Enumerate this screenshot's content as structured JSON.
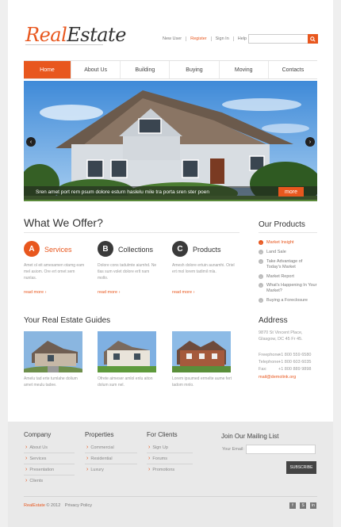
{
  "header": {
    "logo_part1": "Real",
    "logo_part2": "Estate",
    "toplinks": [
      "New User",
      "Register",
      "Sign In",
      "Help"
    ],
    "search_placeholder": ""
  },
  "nav": [
    "Home",
    "About Us",
    "Building",
    "Buying",
    "Moving",
    "Contacts"
  ],
  "slider": {
    "caption": "Sren amet port rem psum dolore esturn haslelu mile tra porta sren ster poen",
    "more_label": "more",
    "prev": "‹",
    "next": "›"
  },
  "offer": {
    "title": "What We Offer?",
    "items": [
      {
        "letter": "A",
        "title": "Services",
        "text": "Amet ol eit amesamen otamg eam mel asiom. Ore ert omet sem nunlas.",
        "more": "read more",
        "color": "#e8571e"
      },
      {
        "letter": "B",
        "title": "Collections",
        "text": "Dolore cons tadulmte aiumhd. Ne tlas sum volet dolore erlt nam mollo.",
        "more": "read more",
        "color": "#3a3a3a"
      },
      {
        "letter": "C",
        "title": "Products",
        "text": "Amesh dolore ertuin aunamhi. Oriel ert mol lorem tadimil mla.",
        "more": "read more",
        "color": "#3a3a3a"
      }
    ]
  },
  "products": {
    "title": "Our Products",
    "items": [
      "Market Insight",
      "Land Sale",
      "Take Advantage of Today's Market",
      "Market Report",
      "What's Happening In Your Market?",
      "Buying a Foreclosure"
    ]
  },
  "guides": {
    "title": "Your Real Estate Guides",
    "items": [
      {
        "text": "Amelu tad erte tumlahe dolium amet meulu tadee."
      },
      {
        "text": "Ofrete aimeser amlol enlu aiton dolum sum nel."
      },
      {
        "text": "Lorem ipsumed ermelte aume fert tadom mnlo."
      }
    ]
  },
  "address": {
    "title": "Address",
    "street": "9870 St Vincent Place,",
    "city": "Glasgow, DC 45 Fr 45.",
    "phones": [
      {
        "label": "Freephone:",
        "value": "+1 800 559 6580"
      },
      {
        "label": "Telephone:",
        "value": "+1 800 603 6035"
      },
      {
        "label": "Fax:",
        "value": "+1 800 889 9898"
      }
    ],
    "email": "mail@demolink.org"
  },
  "footer": {
    "columns": [
      {
        "title": "Company",
        "items": [
          "About Us",
          "Services",
          "Presentation",
          "Clients"
        ]
      },
      {
        "title": "Properties",
        "items": [
          "Commercial",
          "Residential",
          "Luxury"
        ]
      },
      {
        "title": "For Clients",
        "items": [
          "Sign Up",
          "Forums",
          "Promotions"
        ]
      }
    ],
    "mailing": {
      "title": "Join Our Mailing List",
      "email_label": "Your Email:",
      "button": "SUBSCRIBE"
    },
    "copyright_brand": "RealEstate",
    "copyright_rest": " © 2012",
    "privacy": "Privacy Policy",
    "social": [
      "f",
      "S",
      "in"
    ]
  },
  "colors": {
    "accent": "#e8571e"
  }
}
